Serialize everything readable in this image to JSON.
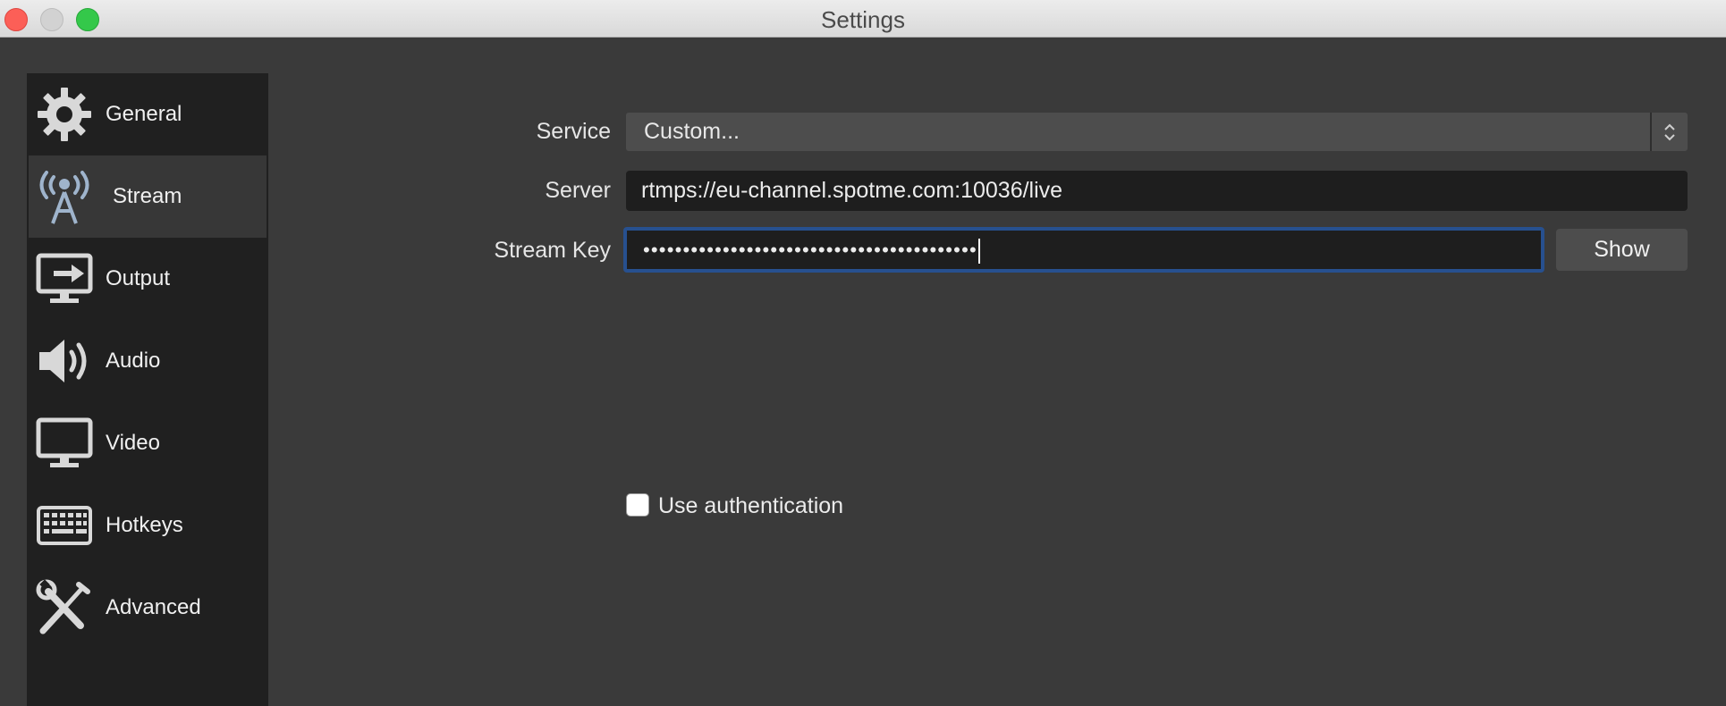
{
  "window": {
    "title": "Settings"
  },
  "sidebar": {
    "items": [
      {
        "label": "General",
        "icon": "gear-icon"
      },
      {
        "label": "Stream",
        "icon": "broadcast-antenna-icon"
      },
      {
        "label": "Output",
        "icon": "monitor-output-icon"
      },
      {
        "label": "Audio",
        "icon": "speaker-icon"
      },
      {
        "label": "Video",
        "icon": "display-icon"
      },
      {
        "label": "Hotkeys",
        "icon": "keyboard-icon"
      },
      {
        "label": "Advanced",
        "icon": "wrench-screwdriver-icon"
      }
    ],
    "active": "Stream"
  },
  "stream": {
    "service_label": "Service",
    "service_value": "Custom...",
    "server_label": "Server",
    "server_value": "rtmps://eu-channel.spotme.com:10036/live",
    "stream_key_label": "Stream Key",
    "stream_key_value": "••••••••••••••••••••••••••••••••••••••••••",
    "show_button": "Show",
    "use_auth_label": "Use authentication",
    "use_auth_checked": false
  },
  "colors": {
    "focus_ring": "#27508f",
    "sidebar_bg": "#202020",
    "content_bg": "#3a3a3a"
  }
}
